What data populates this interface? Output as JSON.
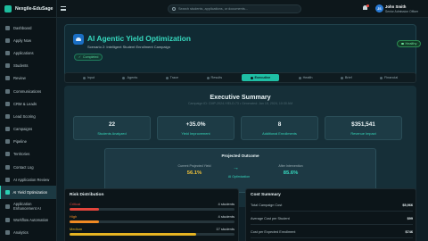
{
  "app": {
    "name": "Nexgile-EduSage"
  },
  "sidebar": {
    "items": [
      {
        "label": "Dashboard"
      },
      {
        "label": "Apply Now"
      },
      {
        "label": "Applications"
      },
      {
        "label": "Students"
      },
      {
        "label": "Review"
      },
      {
        "label": "Communications"
      },
      {
        "label": "CRM & Leads"
      },
      {
        "label": "Lead Scoring"
      },
      {
        "label": "Campaigns"
      },
      {
        "label": "Pipeline"
      },
      {
        "label": "Territories"
      },
      {
        "label": "Contact Log"
      },
      {
        "label": "AI Application Review"
      },
      {
        "label": "AI Yield Optimization",
        "active": true
      },
      {
        "label": "Application Enhancement AI"
      },
      {
        "label": "Workflow Automation"
      },
      {
        "label": "Analytics"
      }
    ]
  },
  "topbar": {
    "search_placeholder": "Search students, applications, or documents...",
    "user_initials": "JS",
    "user_name": "John Smith",
    "user_role": "Senior Admission Officer"
  },
  "header": {
    "title": "AI Agentic Yield Optimization",
    "subtitle": "Scenario 2: Intelligent Student Enrollment Campaign",
    "badge": "Completed",
    "status": "Healthy"
  },
  "steps": [
    {
      "label": "Input"
    },
    {
      "label": "Agents"
    },
    {
      "label": "Trace"
    },
    {
      "label": "Results"
    },
    {
      "label": "Executive",
      "active": true
    },
    {
      "label": "Health"
    },
    {
      "label": "Brief"
    },
    {
      "label": "Financial"
    }
  ],
  "summary": {
    "title": "Executive Summary",
    "meta": "Campaign ID: CMP-2024-YIELD-73 • Generated: Jan 15, 2024, 10:30 AM",
    "metrics": [
      {
        "value": "22",
        "label": "Students Analyzed"
      },
      {
        "value": "+35.0%",
        "label": "Yield Improvement"
      },
      {
        "value": "8",
        "label": "Additional Enrollments"
      },
      {
        "value": "$351,541",
        "label": "Revenue Impact"
      }
    ],
    "outcome": {
      "title": "Projected Outcome",
      "current_label": "Current Projected Yield",
      "current_value": "56.1%",
      "arrow_label": "AI Optimization",
      "after_label": "After Intervention",
      "after_value": "85.6%"
    }
  },
  "risk": {
    "title": "Risk Distribution",
    "rows": [
      {
        "label": "Critical",
        "count": "4 students",
        "color": "#e2453c",
        "fraction": 0.18
      },
      {
        "label": "High",
        "count": "4 students",
        "color": "#f08a24",
        "fraction": 0.18
      },
      {
        "label": "Medium",
        "count": "17 students",
        "color": "#e6b422",
        "fraction": 0.77
      }
    ]
  },
  "cost": {
    "title": "Cost Summary",
    "rows": [
      {
        "label": "Total Campaign Cost",
        "value": "$5,966"
      },
      {
        "label": "Average Cost per Student",
        "value": "$99"
      },
      {
        "label": "Cost per Expected Enrollment",
        "value": "$746"
      }
    ]
  },
  "colors": {
    "accent": "#36d9bf",
    "current_yield": "#f0c23a",
    "after_yield": "#36d9bf"
  }
}
